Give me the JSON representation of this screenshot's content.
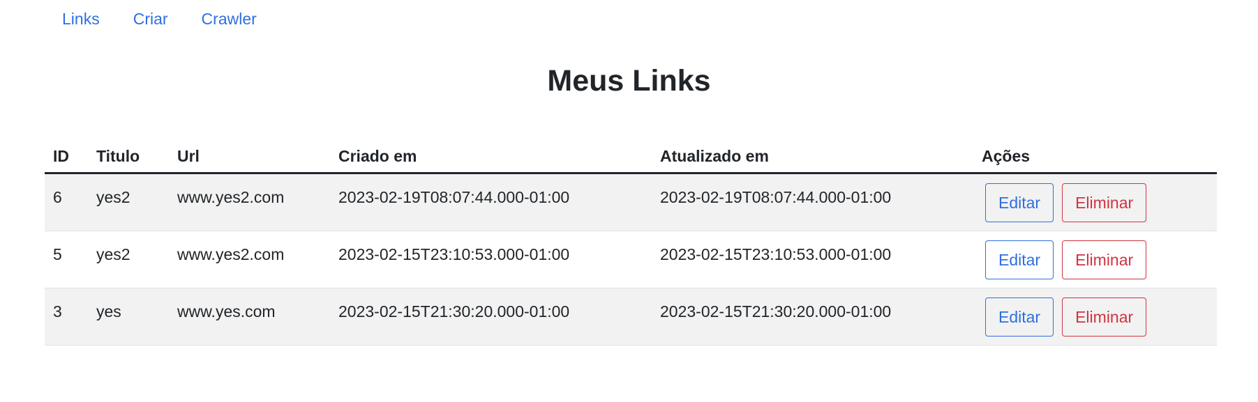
{
  "nav": {
    "items": [
      "Links",
      "Criar",
      "Crawler"
    ]
  },
  "page": {
    "title": "Meus Links"
  },
  "table": {
    "headers": {
      "id": "ID",
      "titulo": "Titulo",
      "url": "Url",
      "criado": "Criado em",
      "atualizado": "Atualizado em",
      "acoes": "Ações"
    },
    "rows": [
      {
        "id": "6",
        "titulo": "yes2",
        "url": "www.yes2.com",
        "criado": "2023-02-19T08:07:44.000-01:00",
        "atualizado": "2023-02-19T08:07:44.000-01:00",
        "edit_label": "Editar",
        "delete_label": "Eliminar"
      },
      {
        "id": "5",
        "titulo": "yes2",
        "url": "www.yes2.com",
        "criado": "2023-02-15T23:10:53.000-01:00",
        "atualizado": "2023-02-15T23:10:53.000-01:00",
        "edit_label": "Editar",
        "delete_label": "Eliminar"
      },
      {
        "id": "3",
        "titulo": "yes",
        "url": "www.yes.com",
        "criado": "2023-02-15T21:30:20.000-01:00",
        "atualizado": "2023-02-15T21:30:20.000-01:00",
        "edit_label": "Editar",
        "delete_label": "Eliminar"
      }
    ]
  },
  "colors": {
    "link": "#2f6fe0",
    "danger": "#d03341",
    "text": "#212529",
    "stripe": "#f2f2f2"
  }
}
